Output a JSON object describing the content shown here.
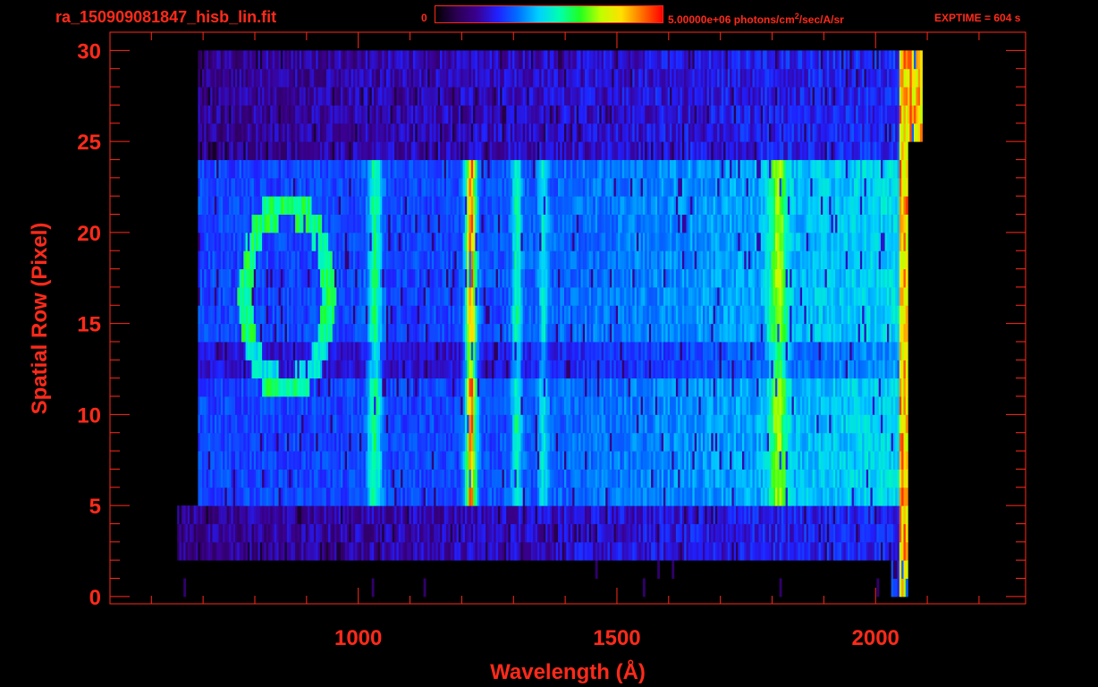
{
  "header": {
    "file_name": "ra_150909081847_hisb_lin.fit",
    "colorbar_min": "0",
    "colorbar_max_value": "5.00000e+06 photons/cm",
    "colorbar_max_exp": "2",
    "colorbar_max_unit": "/sec/A/sr",
    "exptime": "EXPTIME = 604 s"
  },
  "colors": {
    "axis": "#ff2a1a",
    "background": "#000000",
    "colormap": [
      "#000000",
      "#2a0050",
      "#3a0090",
      "#2020ff",
      "#0070ff",
      "#00d0ff",
      "#00ffb0",
      "#20ff20",
      "#c0ff00",
      "#ffe000",
      "#ff7000",
      "#ff0000"
    ]
  },
  "chart_data": {
    "type": "heatmap",
    "title": "ra_150909081847_hisb_lin.fit",
    "xlabel": "Wavelength (Å)",
    "ylabel": "Spatial Row (Pixel)",
    "xlim": [
      520,
      2290
    ],
    "ylim": [
      -0.4,
      31
    ],
    "xticks": [
      1000,
      1500,
      2000
    ],
    "xticklabels": [
      "1000",
      "1500",
      "2000"
    ],
    "yticks": [
      0,
      5,
      10,
      15,
      20,
      25,
      30
    ],
    "yticklabels": [
      "0",
      "5",
      "10",
      "15",
      "20",
      "25",
      "30"
    ],
    "colorbar": {
      "min": 0,
      "max": 5000000,
      "unit": "photons/cm^2/sec/A/sr"
    },
    "detector_range_angstrom": [
      690,
      2060
    ],
    "illuminated_rows": [
      3,
      30
    ],
    "bright_slit_rows": [
      5,
      24
    ],
    "spectral_features": [
      {
        "wavelength": 1030,
        "level": "cyan",
        "rows": [
          7,
          24
        ]
      },
      {
        "wavelength": 1216,
        "level": "red",
        "rows": [
          5,
          24
        ]
      },
      {
        "wavelength": 1304,
        "level": "cyan-green",
        "rows": [
          5,
          23
        ]
      },
      {
        "wavelength": 1356,
        "level": "cyan",
        "rows": [
          7,
          23
        ]
      },
      {
        "wavelength": 1810,
        "level": "green",
        "rows": [
          6,
          23
        ]
      },
      {
        "wavelength": 2055,
        "level": "yellow-red edge",
        "rows": [
          2,
          30
        ]
      }
    ],
    "grid": false
  }
}
